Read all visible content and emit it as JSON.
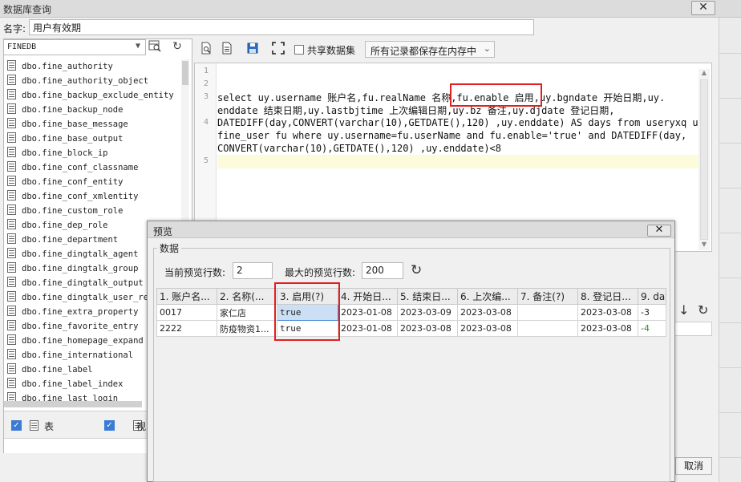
{
  "window": {
    "title": "数据库查询",
    "close_glyph": "✕"
  },
  "name_field": {
    "label": "名字:",
    "value": "用户有效期"
  },
  "left_panel": {
    "database": "FINEDB",
    "tables": [
      "dbo.fine_authority",
      "dbo.fine_authority_object",
      "dbo.fine_backup_exclude_entity",
      "dbo.fine_backup_node",
      "dbo.fine_base_message",
      "dbo.fine_base_output",
      "dbo.fine_block_ip",
      "dbo.fine_conf_classname",
      "dbo.fine_conf_entity",
      "dbo.fine_conf_xmlentity",
      "dbo.fine_custom_role",
      "dbo.fine_dep_role",
      "dbo.fine_department",
      "dbo.fine_dingtalk_agent",
      "dbo.fine_dingtalk_group",
      "dbo.fine_dingtalk_output",
      "dbo.fine_dingtalk_user_rel",
      "dbo.fine_extra_property",
      "dbo.fine_favorite_entry",
      "dbo.fine_homepage_expand",
      "dbo.fine_international",
      "dbo.fine_label",
      "dbo.fine_label_index",
      "dbo.fine_last_login"
    ],
    "footer": {
      "tables_label": "表",
      "views_label": "视"
    }
  },
  "toolbar": {
    "share_label": "共享数据集",
    "memory_option": "所有记录都保存在内存中"
  },
  "editor": {
    "line_numbers": [
      "1",
      "2",
      "3",
      "4",
      "5"
    ],
    "lines": {
      "l3a": "select uy.username 账户名,fu.realName 名称,fu.enable 启用,uy.bgndate 开始日期,uy.",
      "l3b": "enddate 结束日期,uy.lastbjtime 上次编辑日期,uy.bz 备注,uy.djdate 登记日期,",
      "l4a": "DATEDIFF(day,CONVERT(varchar(10),GETDATE(),120) ,uy.enddate) AS days from useryxq uy,",
      "l4b": "fine_user fu where uy.username=fu.userName and fu.enable='true' and DATEDIFF(day,",
      "l4c": "CONVERT(varchar(10),GETDATE(),120) ,uy.enddate)<8"
    }
  },
  "cancel_label": "取消",
  "dialog": {
    "title": "预览",
    "group_label": "数据",
    "current_rows_label": "当前预览行数:",
    "current_rows_value": "2",
    "max_rows_label": "最大的预览行数:",
    "max_rows_value": "200",
    "columns": [
      "1. 账户名...",
      "2. 名称(...",
      "3. 启用(?)",
      "4. 开始日...",
      "5. 结束日...",
      "6. 上次编...",
      "7. 备注(?)",
      "8. 登记日...",
      "9. days"
    ],
    "rows": [
      [
        "0017",
        "家仁店",
        "true",
        "2023-01-08",
        "2023-03-09",
        "2023-03-08",
        "",
        "2023-03-08",
        "-3"
      ],
      [
        "2222",
        "防疫物资1...",
        "true",
        "2023-01-08",
        "2023-03-08",
        "2023-03-08",
        "",
        "2023-03-08",
        "-4"
      ]
    ]
  }
}
